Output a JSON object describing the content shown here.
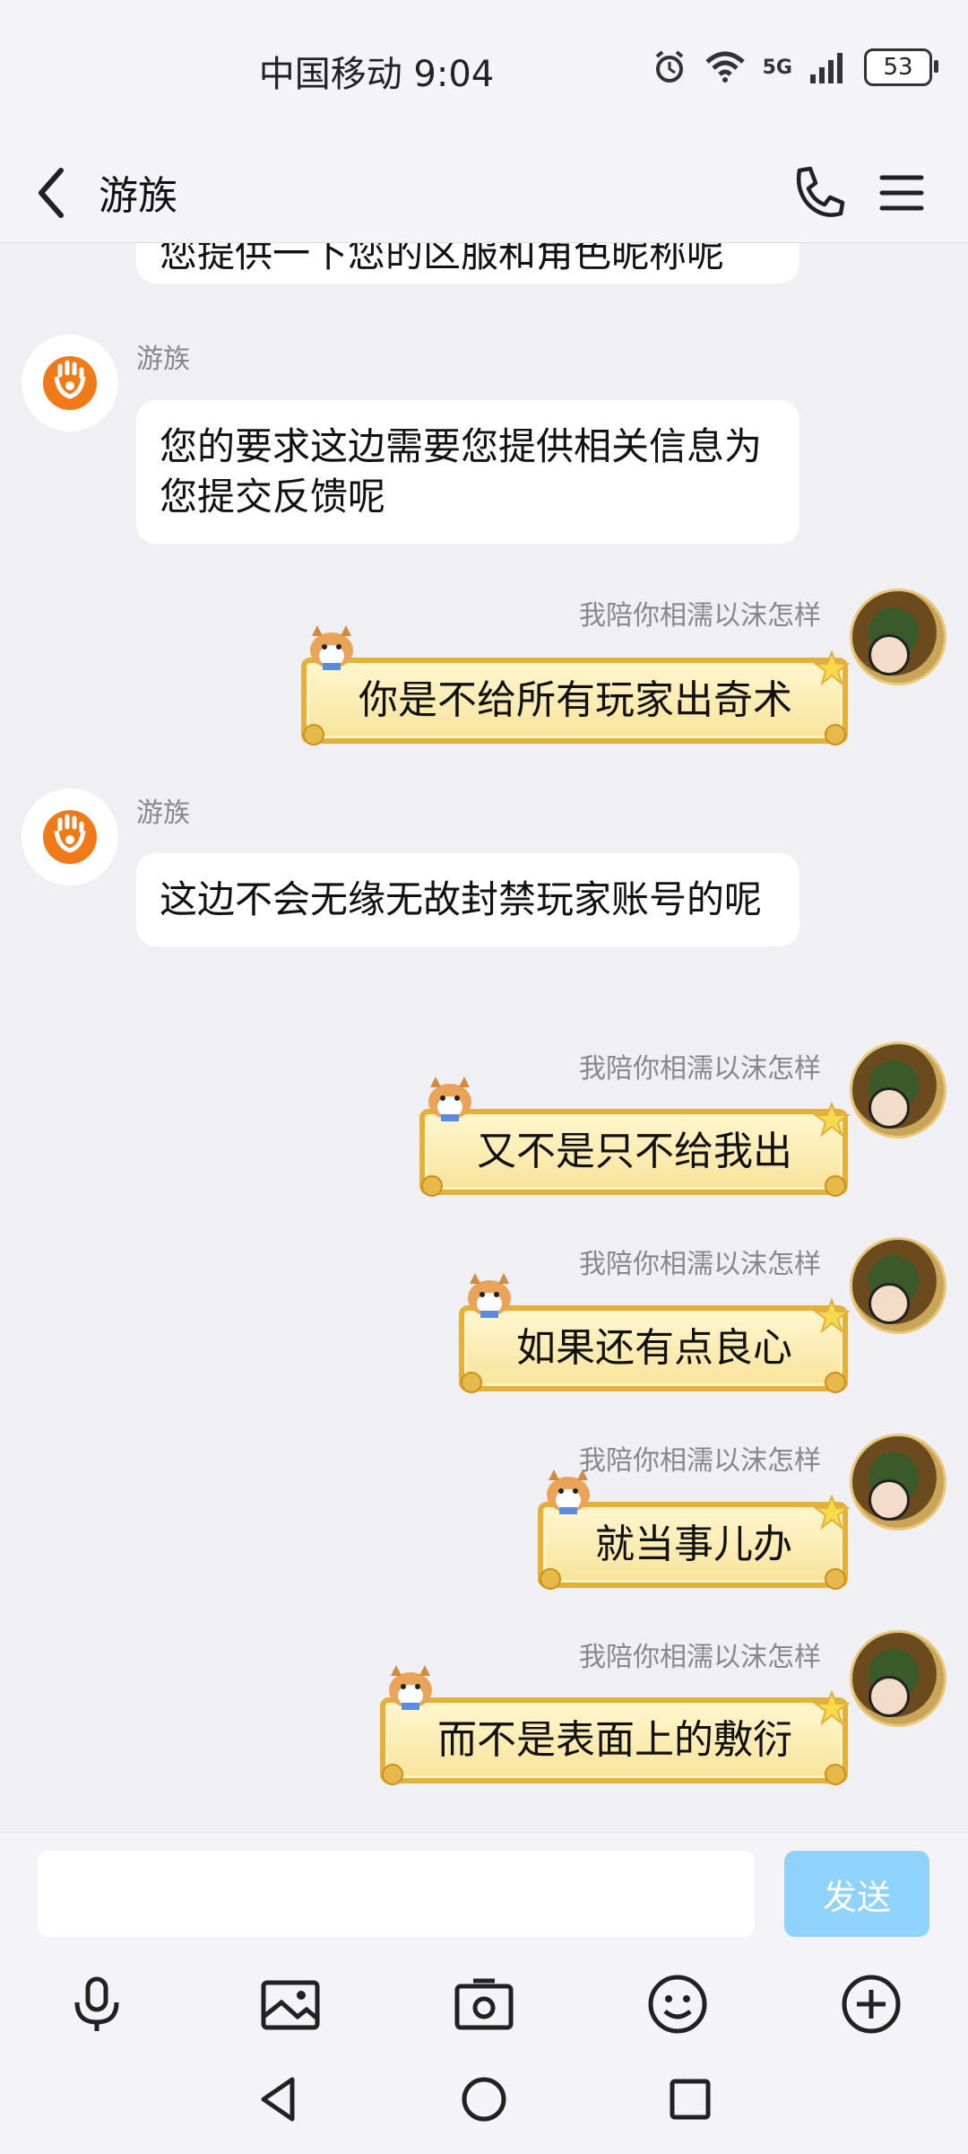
{
  "status_bar": {
    "carrier_time": "中国移动 9:04",
    "network": "5G",
    "battery": "53"
  },
  "header": {
    "title": "游族"
  },
  "messages": {
    "partial_text": "您提供一下您的区服和角色昵称呢",
    "m1": {
      "sender": "游族",
      "text": "您的要求这边需要您提供相关信息为您提交反馈呢"
    },
    "m2": {
      "sender": "我陪你相濡以沫怎样",
      "text": "你是不给所有玩家出奇术"
    },
    "m3": {
      "sender": "游族",
      "text": "这边不会无缘无故封禁玩家账号的呢"
    },
    "m4": {
      "sender": "我陪你相濡以沫怎样",
      "text": "又不是只不给我出"
    },
    "m5": {
      "sender": "我陪你相濡以沫怎样",
      "text": "如果还有点良心"
    },
    "m6": {
      "sender": "我陪你相濡以沫怎样",
      "text": "就当事儿办"
    },
    "m7": {
      "sender": "我陪你相濡以沫怎样",
      "text": "而不是表面上的敷衍"
    }
  },
  "composer": {
    "input_value": "",
    "send_label": "发送"
  },
  "colors": {
    "background": "#efeff4",
    "send_button": "#8fd2fb",
    "brand_orange": "#f07a1a",
    "scroll_border": "#e2b13c"
  }
}
